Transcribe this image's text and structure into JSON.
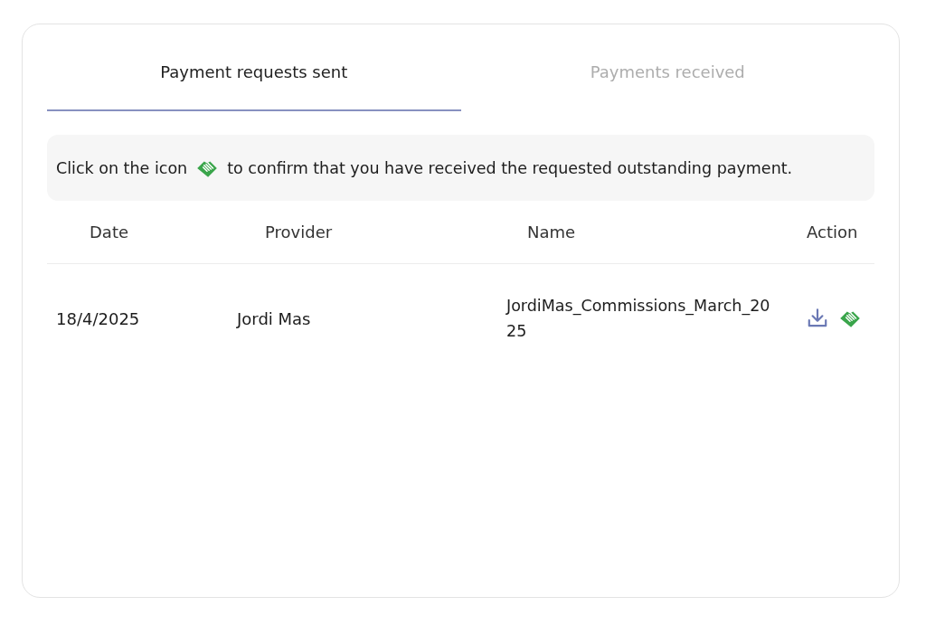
{
  "tabs": [
    {
      "label": "Payment requests sent",
      "selected": true
    },
    {
      "label": "Payments received",
      "selected": false
    }
  ],
  "notice": {
    "before": "Click on the icon",
    "after": "to confirm that you have received the requested outstanding payment."
  },
  "table": {
    "columns": [
      "Date",
      "Provider",
      "Name",
      "Action"
    ],
    "rows": [
      {
        "date": "18/4/2025",
        "provider": "Jordi Mas",
        "name": "JordiMas_Commissions_March_2025",
        "actions": [
          {
            "kind": "download"
          },
          {
            "kind": "confirm"
          }
        ]
      }
    ]
  }
}
